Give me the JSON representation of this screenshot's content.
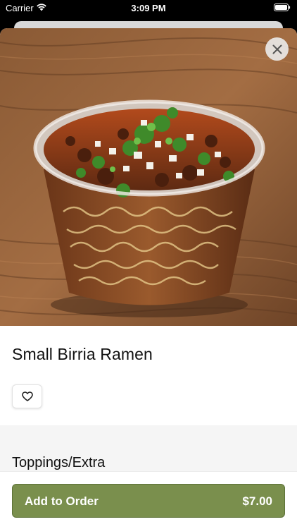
{
  "status_bar": {
    "carrier": "Carrier",
    "time": "3:09 PM",
    "icons": [
      "wifi-icon",
      "battery-icon"
    ]
  },
  "hero": {
    "image_description": "Birria ramen in a clear plastic cup on a wooden table",
    "close_icon": "close-icon"
  },
  "item": {
    "title": "Small Birria Ramen",
    "favorite_icon": "heart-icon"
  },
  "sections": {
    "toppings_title": "Toppings/Extra"
  },
  "order_bar": {
    "add_label": "Add to Order",
    "price": "$7.00"
  },
  "colors": {
    "accent": "#7a8f4d",
    "background_dark": "#000000",
    "section_band": "#f5f5f5"
  }
}
